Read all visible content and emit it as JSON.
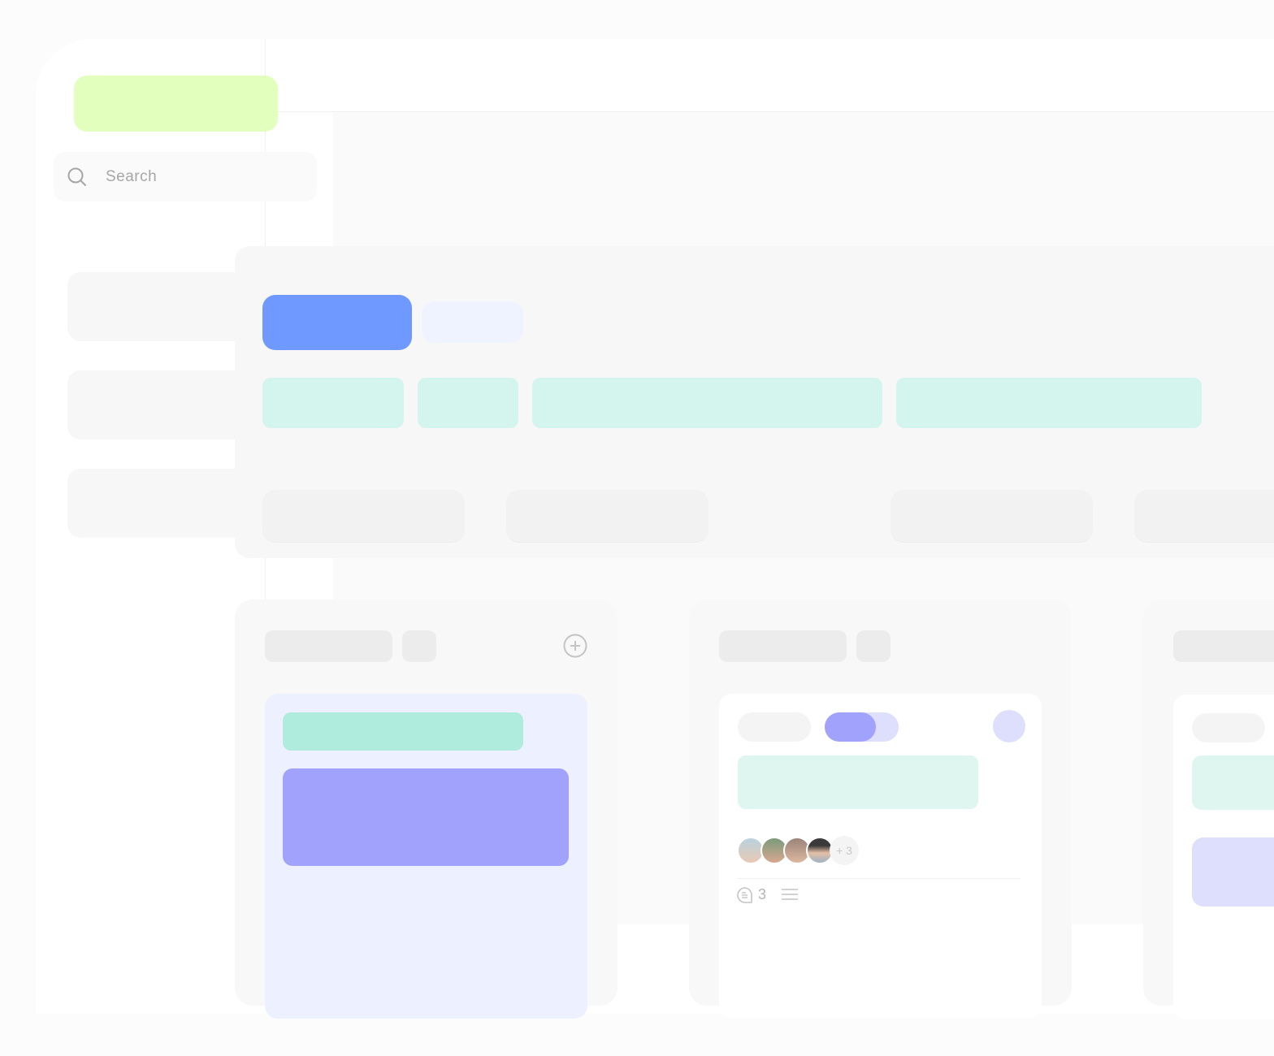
{
  "colors": {
    "logo": "#e0ffb6",
    "primary": "#6f99ff",
    "secondary": "#eff2ff",
    "chip": "#d3f5ee",
    "tag_green": "#afecdd",
    "purple": "#a0a2fb",
    "lavender": "#dedefd"
  },
  "sidebar": {
    "search": {
      "placeholder": "Search",
      "icon": "search-icon"
    },
    "items": [
      {
        "name": "nav-item-1"
      },
      {
        "name": "nav-item-2"
      },
      {
        "name": "nav-item-3"
      }
    ]
  },
  "board": {
    "columns": [
      {
        "add_icon": "plus-circle-icon"
      },
      {
        "card": {
          "assignees_overflow": "+ 3",
          "comments_count": "3",
          "comment_icon": "comment-icon",
          "description_icon": "menu-lines-icon"
        }
      },
      {}
    ]
  }
}
